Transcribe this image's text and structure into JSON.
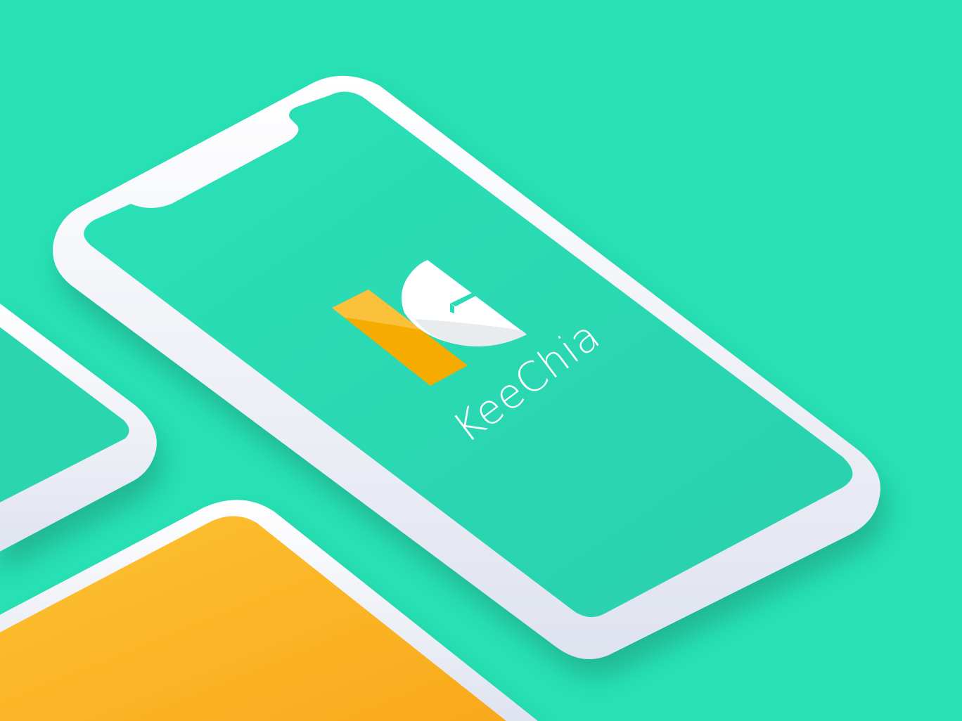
{
  "app": {
    "name": "KeeChia"
  },
  "colors": {
    "background": "#27e0b4",
    "screen_primary": "#2adcb5",
    "screen_secondary": "#2bd3ae",
    "frame": "#ffffff",
    "logo_orange": "#f6ab00",
    "logo_orange_light": "#fbc13a",
    "logo_white": "#ffffff",
    "accent_yellow": "#fbb829"
  },
  "icons": {
    "logo": "keechia-k-logo"
  }
}
